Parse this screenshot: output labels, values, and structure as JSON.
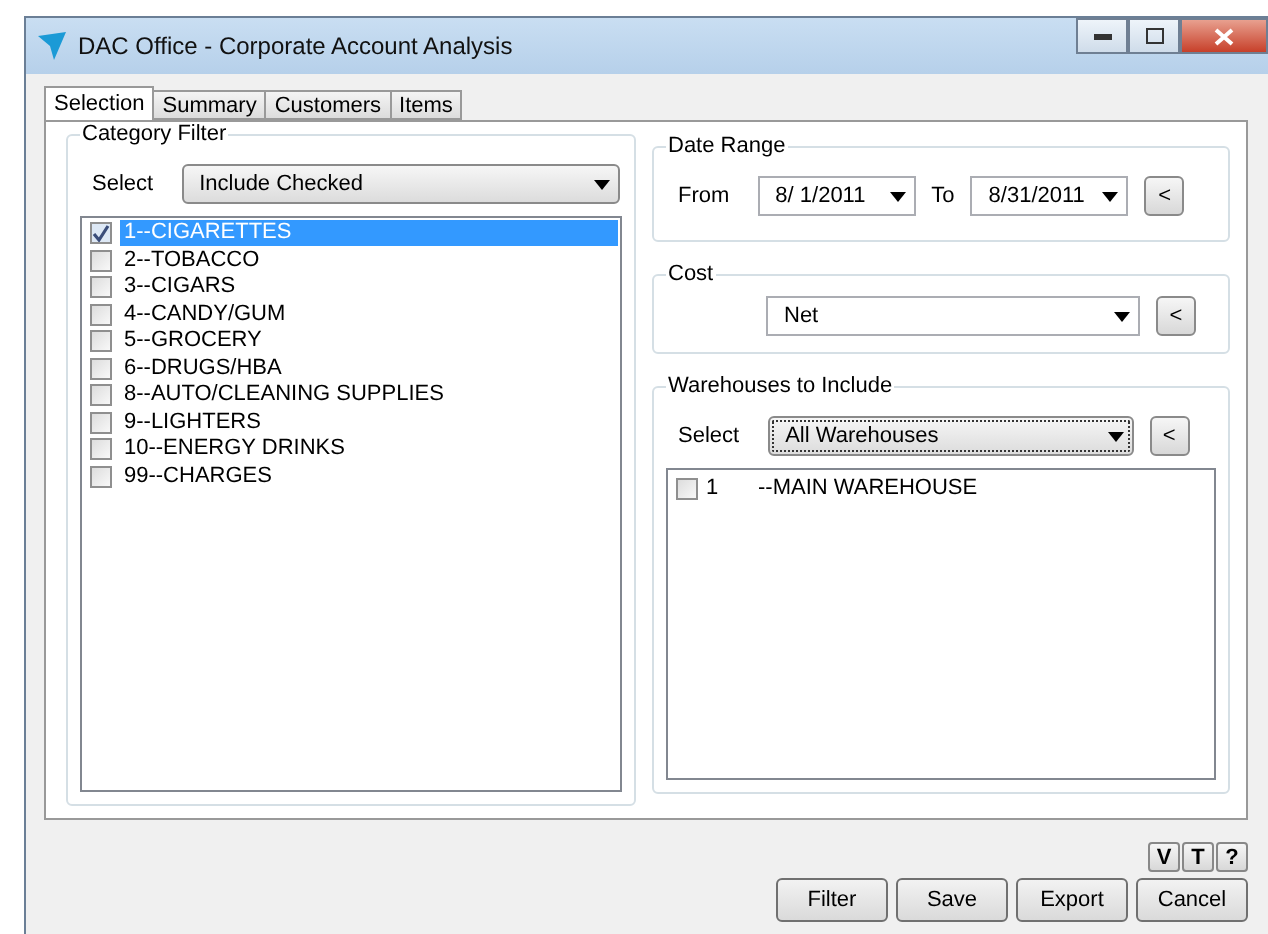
{
  "window": {
    "title": "DAC Office - Corporate Account Analysis"
  },
  "tabs": [
    {
      "label": "Selection",
      "selected": true
    },
    {
      "label": "Summary",
      "selected": false
    },
    {
      "label": "Customers",
      "selected": false
    },
    {
      "label": "Items",
      "selected": false
    }
  ],
  "category_filter": {
    "title": "Category Filter",
    "select_label": "Select",
    "select_value": "Include Checked",
    "items": [
      {
        "label": "1--CIGARETTES",
        "checked": true,
        "selected": true
      },
      {
        "label": "2--TOBACCO",
        "checked": false,
        "selected": false
      },
      {
        "label": "3--CIGARS",
        "checked": false,
        "selected": false
      },
      {
        "label": "4--CANDY/GUM",
        "checked": false,
        "selected": false
      },
      {
        "label": "5--GROCERY",
        "checked": false,
        "selected": false
      },
      {
        "label": "6--DRUGS/HBA",
        "checked": false,
        "selected": false
      },
      {
        "label": "8--AUTO/CLEANING SUPPLIES",
        "checked": false,
        "selected": false
      },
      {
        "label": "9--LIGHTERS",
        "checked": false,
        "selected": false
      },
      {
        "label": "10--ENERGY DRINKS",
        "checked": false,
        "selected": false
      },
      {
        "label": "99--CHARGES",
        "checked": false,
        "selected": false
      }
    ]
  },
  "date_range": {
    "title": "Date Range",
    "from_label": "From",
    "from": "8/ 1/2011",
    "to_label": "To",
    "to": "8/31/2011",
    "reset": "<"
  },
  "cost": {
    "title": "Cost",
    "value": "Net",
    "reset": "<"
  },
  "warehouses": {
    "title": "Warehouses to Include",
    "select_label": "Select",
    "select_value": "All Warehouses",
    "reset": "<",
    "items": [
      {
        "number": "1",
        "name": "--MAIN WAREHOUSE",
        "checked": false
      }
    ]
  },
  "small_buttons": [
    "V",
    "T",
    "?"
  ],
  "buttons": [
    "Filter",
    "Save",
    "Export",
    "Cancel"
  ]
}
